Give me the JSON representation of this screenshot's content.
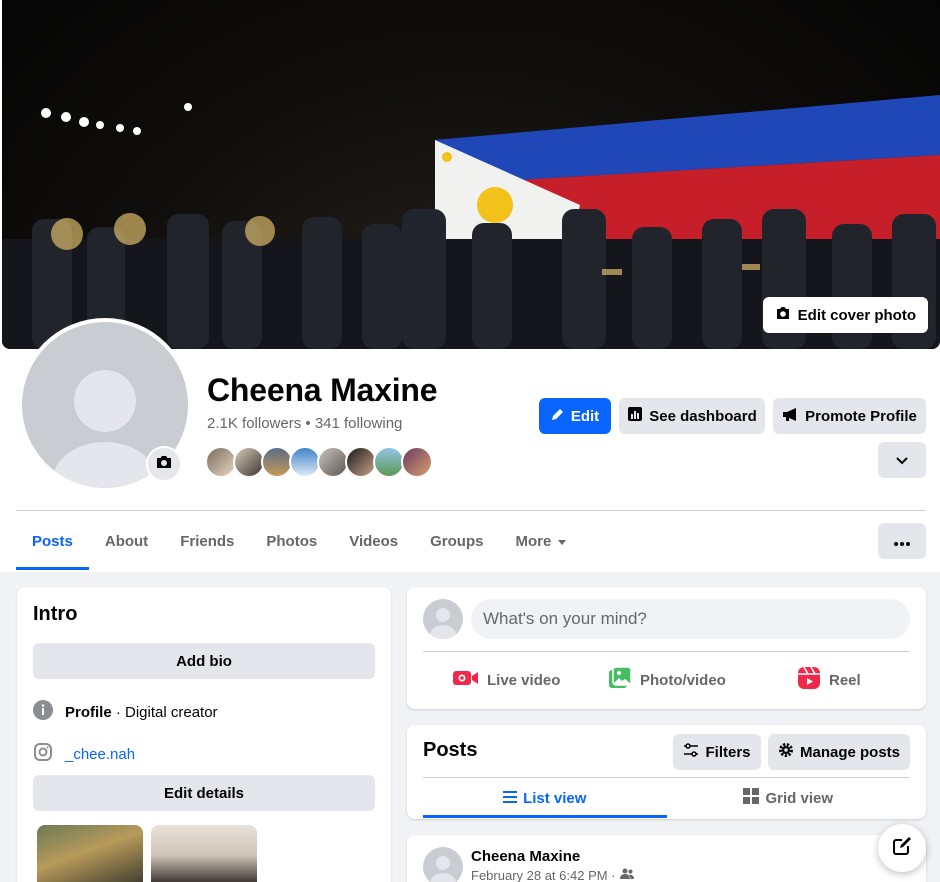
{
  "profile": {
    "name": "Cheena Maxine",
    "followers": "2.1K followers",
    "separator": " • ",
    "following": "341 following",
    "edit_cover": "Edit cover photo"
  },
  "actions": {
    "edit": "Edit",
    "dashboard": "See dashboard",
    "promote": "Promote Profile"
  },
  "tabs": [
    {
      "label": "Posts",
      "active": true
    },
    {
      "label": "About"
    },
    {
      "label": "Friends"
    },
    {
      "label": "Photos"
    },
    {
      "label": "Videos"
    },
    {
      "label": "Groups"
    },
    {
      "label": "More"
    }
  ],
  "intro": {
    "title": "Intro",
    "add_bio": "Add bio",
    "profile_label": "Profile",
    "profile_type": " · Digital creator",
    "instagram": "_chee.nah",
    "edit_details": "Edit details"
  },
  "composer": {
    "placeholder": "What's on your mind?",
    "live": "Live video",
    "photo": "Photo/video",
    "reel": "Reel"
  },
  "posts": {
    "title": "Posts",
    "filters": "Filters",
    "manage": "Manage posts",
    "list_view": "List view",
    "grid_view": "Grid view"
  },
  "post": {
    "author": "Cheena Maxine",
    "date": "February 28 at 6:42 PM ·"
  },
  "colors": {
    "accent": "#0866ff",
    "button_gray": "#e4e6eb",
    "page_bg": "#f0f2f5"
  }
}
